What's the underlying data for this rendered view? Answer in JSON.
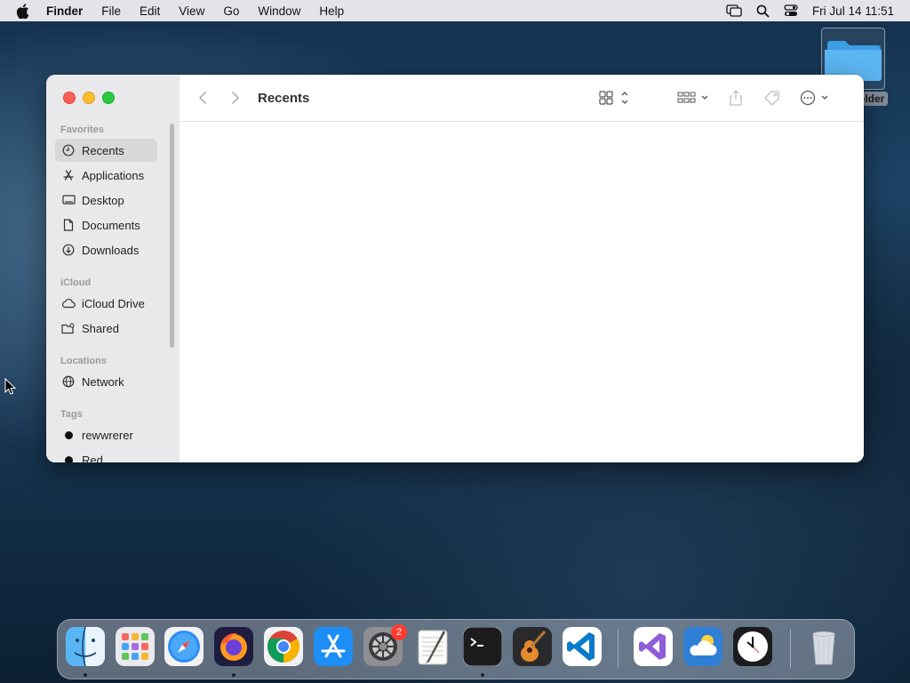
{
  "menubar": {
    "app_name": "Finder",
    "items": [
      "File",
      "Edit",
      "View",
      "Go",
      "Window",
      "Help"
    ],
    "clock": "Fri Jul 14  11:51"
  },
  "desktop": {
    "folder_label": "older"
  },
  "finder": {
    "title": "Recents",
    "sidebar": {
      "favorites_title": "Favorites",
      "favorites": [
        {
          "label": "Recents",
          "icon": "clock-icon"
        },
        {
          "label": "Applications",
          "icon": "applications-icon"
        },
        {
          "label": "Desktop",
          "icon": "desktop-icon"
        },
        {
          "label": "Documents",
          "icon": "document-icon"
        },
        {
          "label": "Downloads",
          "icon": "download-icon"
        }
      ],
      "icloud_title": "iCloud",
      "icloud": [
        {
          "label": "iCloud Drive",
          "icon": "cloud-icon"
        },
        {
          "label": "Shared",
          "icon": "shared-folder-icon"
        }
      ],
      "locations_title": "Locations",
      "locations": [
        {
          "label": "Network",
          "icon": "globe-icon"
        }
      ],
      "tags_title": "Tags",
      "tags": [
        {
          "label": "rewwrerer",
          "color": "#111111"
        },
        {
          "label": "Red",
          "color": "#111111"
        }
      ]
    }
  },
  "dock": {
    "badge_count": "2",
    "apps": [
      "Finder",
      "Launchpad",
      "Safari",
      "Firefox",
      "Chrome",
      "App Store",
      "System Preferences",
      "TextEdit",
      "Terminal",
      "GarageBand",
      "VS Code",
      "Visual Studio",
      "Weather",
      "Clock",
      "Trash"
    ]
  }
}
